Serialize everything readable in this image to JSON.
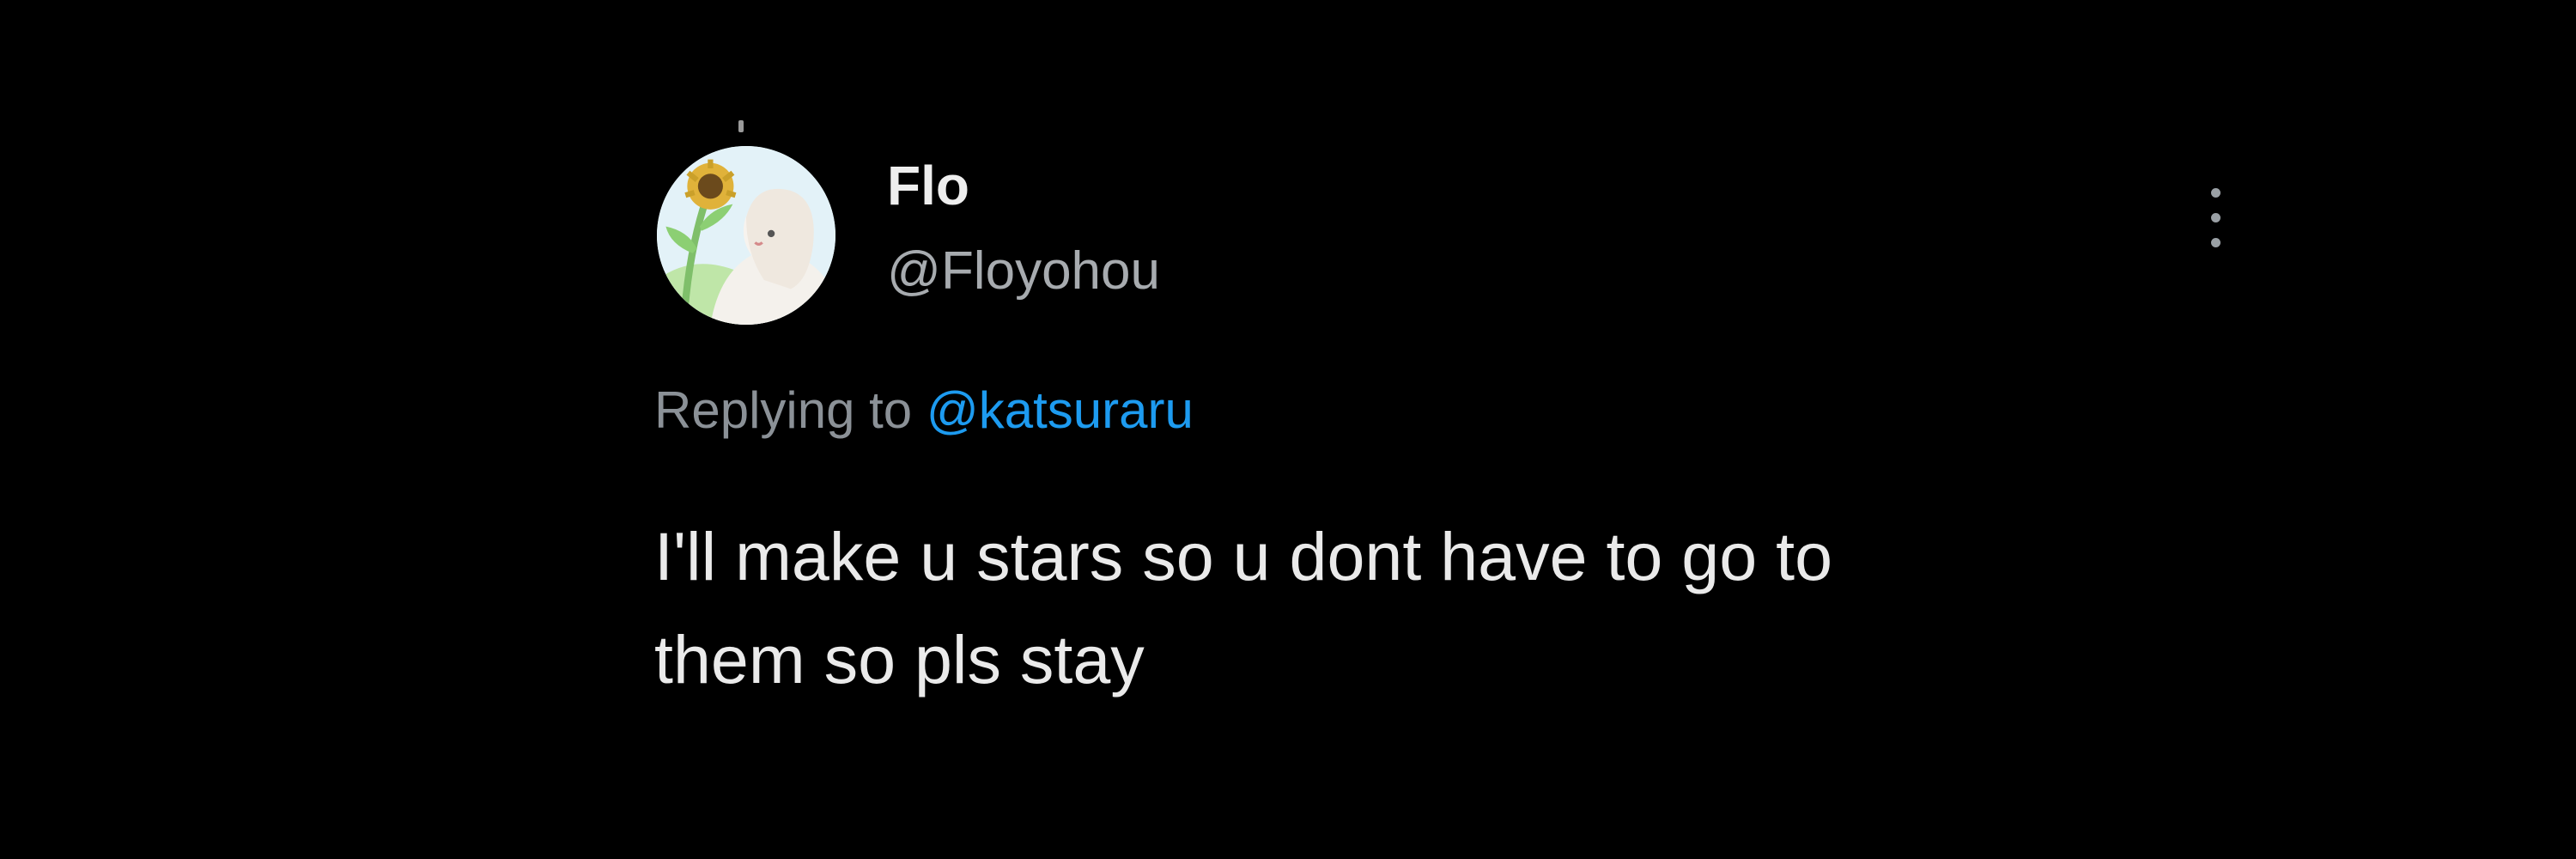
{
  "tweet": {
    "display_name": "Flo",
    "handle": "@Floyohou",
    "avatar_icon": "profile-avatar-illustration",
    "more_icon": "more-options-icon",
    "replying_prefix": "Replying to",
    "replying_to": "@katsuraru",
    "text_lines": [
      "I'll make u stars so u dont have to go to",
      "them so pls stay"
    ]
  },
  "colors": {
    "background": "#000000",
    "mention": "#1d9bf0",
    "secondary_text": "#8b9197"
  }
}
